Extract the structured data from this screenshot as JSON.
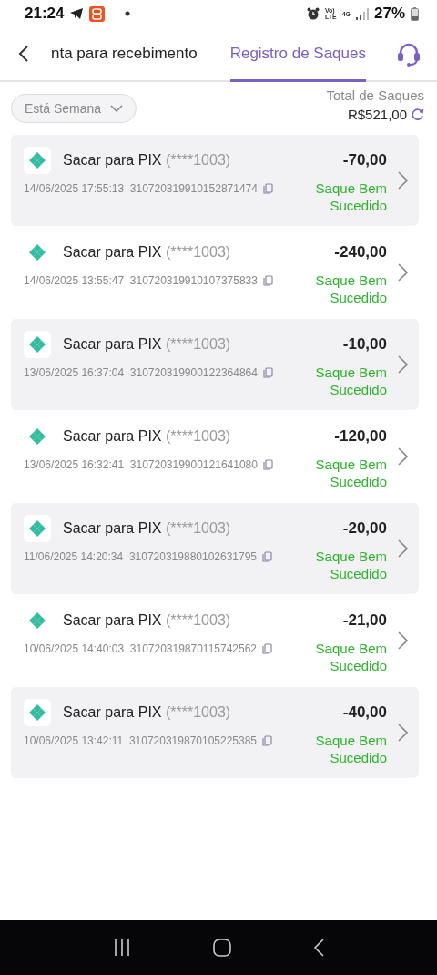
{
  "status_bar": {
    "time": "21:24",
    "volte_top": "Vo)",
    "volte_bottom": "LTE",
    "network": "4G",
    "battery": "27%"
  },
  "tabs": [
    {
      "label": "nta para recebimento",
      "selected": false
    },
    {
      "label": "Registro de Saques",
      "selected": true
    }
  ],
  "filter": {
    "label": "Está Semana"
  },
  "total": {
    "label": "Total de Saques",
    "amount": "R$521,00"
  },
  "records": [
    {
      "title": "Sacar para PIX",
      "account": "(****1003)",
      "amount": "-70,00",
      "datetime": "14/06/2025 17:55:13",
      "reference": "310720319910152871474",
      "status": "Saque Bem Sucedido"
    },
    {
      "title": "Sacar para PIX",
      "account": "(****1003)",
      "amount": "-240,00",
      "datetime": "14/06/2025 13:55:47",
      "reference": "310720319910107375833",
      "status": "Saque Bem Sucedido"
    },
    {
      "title": "Sacar para PIX",
      "account": "(****1003)",
      "amount": "-10,00",
      "datetime": "13/06/2025 16:37:04",
      "reference": "310720319900122364864",
      "status": "Saque Bem Sucedido"
    },
    {
      "title": "Sacar para PIX",
      "account": "(****1003)",
      "amount": "-120,00",
      "datetime": "13/06/2025 16:32:41",
      "reference": "310720319900121641080",
      "status": "Saque Bem Sucedido"
    },
    {
      "title": "Sacar para PIX",
      "account": "(****1003)",
      "amount": "-20,00",
      "datetime": "11/06/2025 14:20:34",
      "reference": "310720319880102631795",
      "status": "Saque Bem Sucedido"
    },
    {
      "title": "Sacar para PIX",
      "account": "(****1003)",
      "amount": "-21,00",
      "datetime": "10/06/2025 14:40:03",
      "reference": "310720319870115742562",
      "status": "Saque Bem Sucedido"
    },
    {
      "title": "Sacar para PIX",
      "account": "(****1003)",
      "amount": "-40,00",
      "datetime": "10/06/2025 13:42:11",
      "reference": "310720319870105225385",
      "status": "Saque Bem Sucedido"
    }
  ]
}
